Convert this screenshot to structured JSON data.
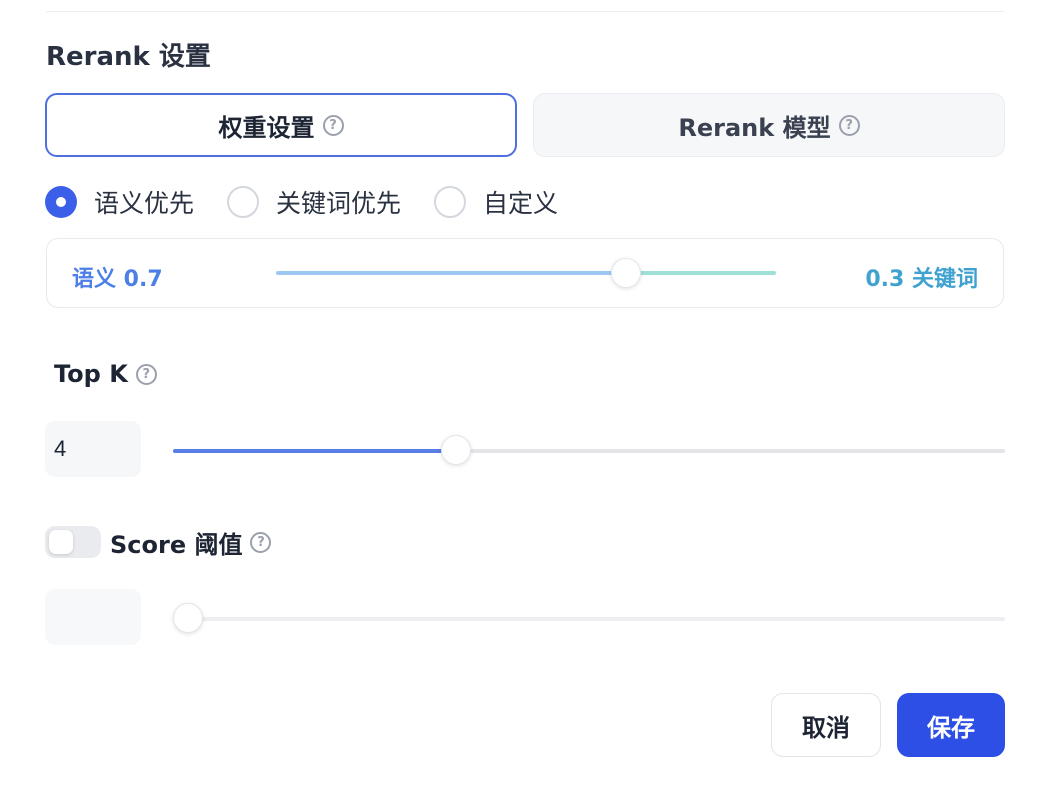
{
  "section": {
    "title": "Rerank 设置"
  },
  "tabs": [
    {
      "label": "权重设置",
      "active": true
    },
    {
      "label": "Rerank 模型",
      "active": false
    }
  ],
  "help_icon_glyph": "?",
  "mode_options": [
    {
      "label": "语义优先",
      "checked": true
    },
    {
      "label": "关键词优先",
      "checked": false
    },
    {
      "label": "自定义",
      "checked": false
    }
  ],
  "weights": {
    "semantic_label": "语义 0.7",
    "keyword_label": "0.3 关键词",
    "semantic_value": 0.7,
    "keyword_value": 0.3
  },
  "top_k": {
    "label": "Top K",
    "value": "4",
    "slider_fraction": 0.34
  },
  "score_threshold": {
    "label": "Score 阈值",
    "enabled": false,
    "value": "",
    "slider_fraction": 0.0
  },
  "buttons": {
    "cancel": "取消",
    "save": "保存"
  },
  "colors": {
    "primary": "#2d4fe6",
    "semantic": "#4d7fe8",
    "keyword": "#40a2cf"
  }
}
